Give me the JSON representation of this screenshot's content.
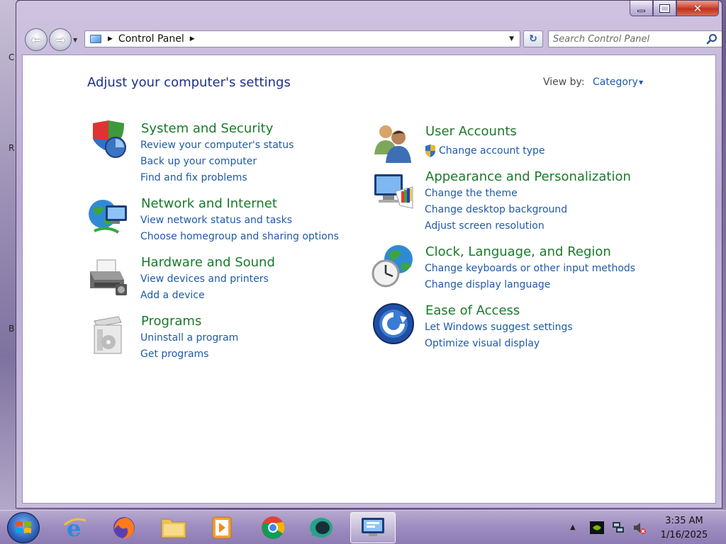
{
  "desktop": {
    "fragments": [
      "C",
      "R",
      "B"
    ]
  },
  "window": {
    "caption": {
      "minimize": "minimize",
      "maximize": "maximize",
      "close": "✕"
    },
    "nav": {
      "back": "←",
      "forward": "→",
      "breadcrumb": "Control Panel",
      "refresh": "↻"
    },
    "search": {
      "placeholder": "Search Control Panel"
    }
  },
  "content": {
    "title": "Adjust your computer's settings",
    "view_by": {
      "label": "View by:",
      "value": "Category"
    },
    "left_categories": [
      {
        "icon": "shield-security-icon",
        "title": "System and Security",
        "links": [
          "Review your computer's status",
          "Back up your computer",
          "Find and fix problems"
        ]
      },
      {
        "icon": "globe-network-icon",
        "title": "Network and Internet",
        "links": [
          "View network status and tasks",
          "Choose homegroup and sharing options"
        ]
      },
      {
        "icon": "printer-hardware-icon",
        "title": "Hardware and Sound",
        "links": [
          "View devices and printers",
          "Add a device"
        ]
      },
      {
        "icon": "programs-box-icon",
        "title": "Programs",
        "links": [
          "Uninstall a program",
          "Get programs"
        ]
      }
    ],
    "right_categories": [
      {
        "icon": "users-icon",
        "title": "User Accounts",
        "links": [
          "Change account type"
        ]
      },
      {
        "icon": "monitor-palette-icon",
        "title": "Appearance and Personalization",
        "links": [
          "Change the theme",
          "Change desktop background",
          "Adjust screen resolution"
        ]
      },
      {
        "icon": "clock-globe-icon",
        "title": "Clock, Language, and Region",
        "links": [
          "Change keyboards or other input methods",
          "Change display language"
        ]
      },
      {
        "icon": "ease-of-access-icon",
        "title": "Ease of Access",
        "links": [
          "Let Windows suggest settings",
          "Optimize visual display"
        ]
      }
    ]
  },
  "taskbar": {
    "items": [
      "start-orb",
      "internet-explorer",
      "firefox",
      "file-explorer",
      "media-player",
      "chrome",
      "chat-app",
      "control-panel"
    ],
    "tray": [
      "show-hidden-icons",
      "nvidia-icon",
      "network-icon",
      "volume-muted-icon"
    ],
    "time": "3:35 AM",
    "date": "1/16/2025"
  }
}
